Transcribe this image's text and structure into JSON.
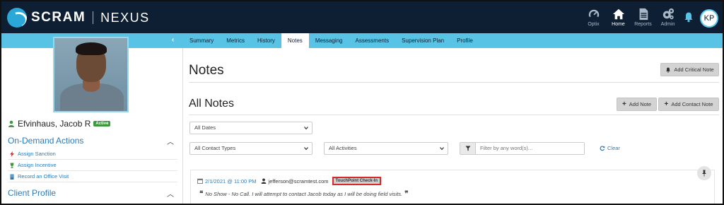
{
  "header": {
    "brand": "SCRAM",
    "product": "NEXUS",
    "nav": [
      {
        "label": "Optix",
        "icon": "gauge-icon"
      },
      {
        "label": "Home",
        "icon": "home-icon"
      },
      {
        "label": "Reports",
        "icon": "document-icon"
      },
      {
        "label": "Admin",
        "icon": "gears-icon"
      }
    ],
    "avatar_initials": "KP"
  },
  "tabs": [
    "Summary",
    "Metrics",
    "History",
    "Notes",
    "Messaging",
    "Assessments",
    "Supervision Plan",
    "Profile"
  ],
  "active_tab": "Notes",
  "client": {
    "name": "Efvinhaus, Jacob R",
    "status": "Active"
  },
  "sidebar": {
    "on_demand_title": "On-Demand Actions",
    "actions": [
      "Assign Sanction",
      "Assign Incentive",
      "Record an Office Visit"
    ],
    "client_profile_title": "Client Profile"
  },
  "main": {
    "page_title": "Notes",
    "add_critical_note": "Add Critical Note",
    "section_title": "All Notes",
    "add_note": "Add Note",
    "add_contact_note": "Add Contact Note",
    "filters": {
      "dates": "All Dates",
      "contact_types": "All Contact Types",
      "activities": "All Activities",
      "search_placeholder": "Filter by any word(s)...",
      "clear": "Clear"
    }
  },
  "notes": [
    {
      "date": "2/1/2021 @ 11:00 PM",
      "user": "jefferson@scramtest.com",
      "tag": "TouchPoint Check-In",
      "text": "No Show - No Call. I will attempt to contact Jacob today as I will be doing field visits."
    }
  ],
  "colors": {
    "header_bg": "#0f1f33",
    "strip_bg": "#59c3e5",
    "link": "#2b7bb9",
    "active_badge": "#3c9a3c",
    "tag_border": "#d62b2b"
  }
}
